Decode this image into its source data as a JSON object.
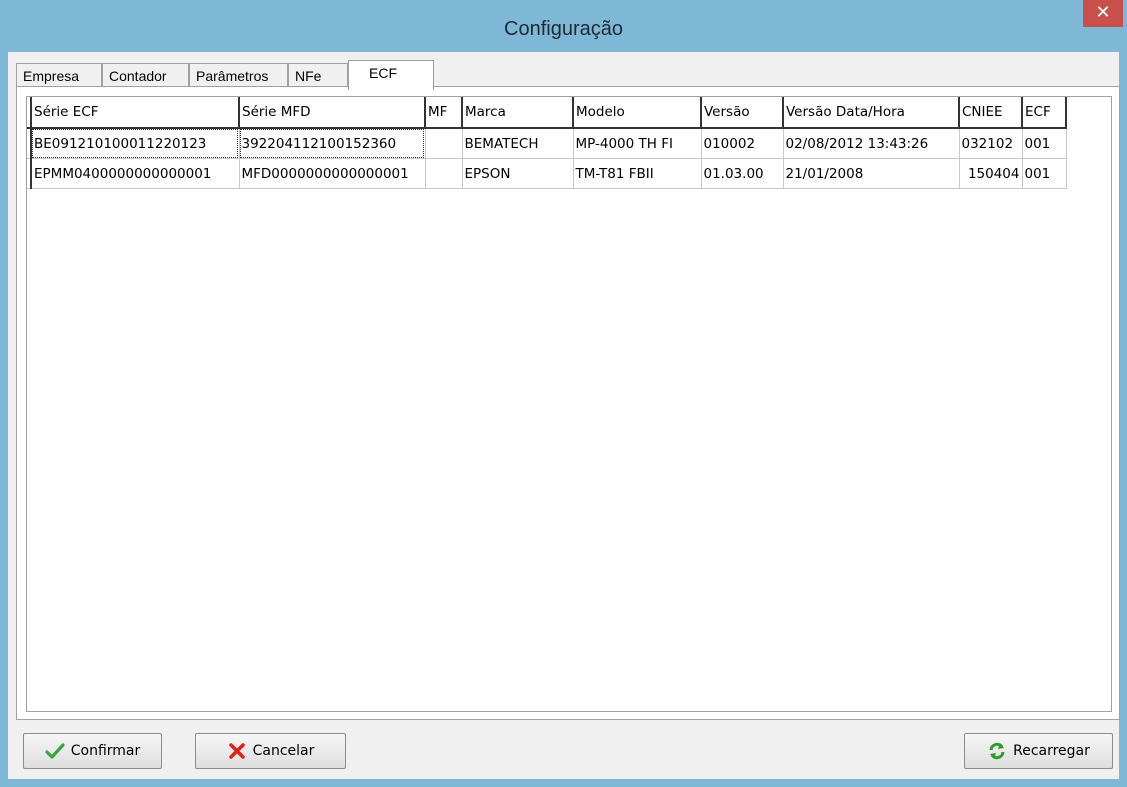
{
  "window": {
    "title": "Configuração",
    "close_glyph": "✕"
  },
  "tabs": [
    {
      "label": "Empresa"
    },
    {
      "label": "Contador"
    },
    {
      "label": "Parâmetros"
    },
    {
      "label": "NFe"
    },
    {
      "label": "ECF"
    }
  ],
  "active_tab": "ECF",
  "grid": {
    "columns": [
      "Série ECF",
      "Série MFD",
      "MF",
      "Marca",
      "Modelo",
      "Versão",
      "Versão Data/Hora",
      "CNIEE",
      "ECF"
    ],
    "rows": [
      [
        "BE091210100011220123",
        "392204112100152360",
        "",
        "BEMATECH",
        "MP-4000 TH FI",
        "010002",
        "02/08/2012 13:43:26",
        "032102",
        "001"
      ],
      [
        "EPMM0400000000000001",
        "MFD0000000000000001",
        "",
        "EPSON",
        "TM-T81 FBII",
        "01.03.00",
        "21/01/2008",
        "150404",
        "001"
      ]
    ]
  },
  "buttons": {
    "confirm": "Confirmar",
    "cancel": "Cancelar",
    "reload": "Recarregar"
  },
  "icons": {
    "confirm": "check-icon",
    "cancel": "x-icon",
    "reload": "refresh-icon"
  },
  "colors": {
    "titlebar": "#7fb8d6",
    "close": "#c7504a",
    "check": "#3aa33a",
    "cancel": "#d9261c",
    "reload": "#2e9b2e"
  }
}
